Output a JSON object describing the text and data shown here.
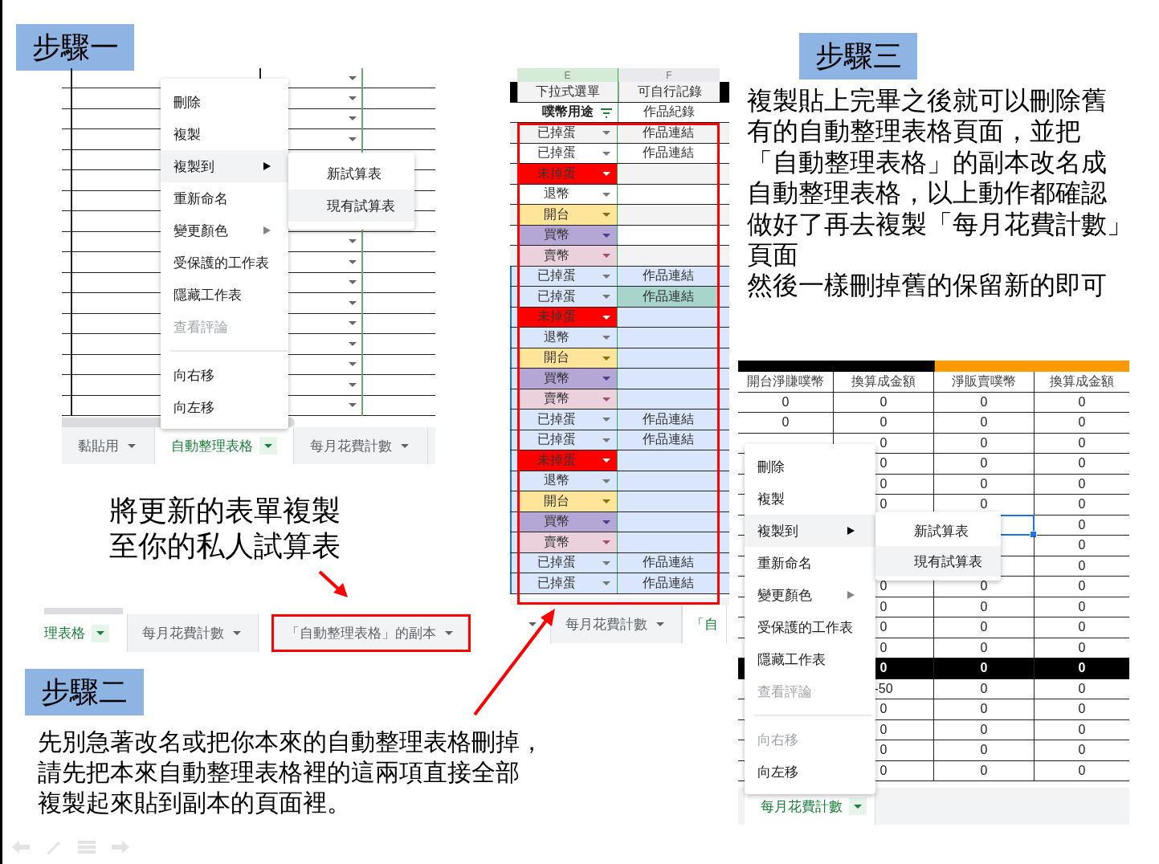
{
  "step1": {
    "label": "步驟一"
  },
  "sheet_a": {
    "menu": [
      {
        "kind": "item",
        "label": "刪除",
        "selected": false,
        "disabled": false,
        "submenu": false
      },
      {
        "kind": "item",
        "label": "複製",
        "selected": false,
        "disabled": false,
        "submenu": false
      },
      {
        "kind": "item",
        "label": "複製到",
        "selected": true,
        "disabled": false,
        "submenu": true
      },
      {
        "kind": "item",
        "label": "重新命名",
        "selected": false,
        "disabled": false,
        "submenu": false
      },
      {
        "kind": "item",
        "label": "變更顏色",
        "selected": false,
        "disabled": false,
        "submenu": true
      },
      {
        "kind": "item",
        "label": "受保護的工作表",
        "selected": false,
        "disabled": false,
        "submenu": false
      },
      {
        "kind": "item",
        "label": "隱藏工作表",
        "selected": false,
        "disabled": false,
        "submenu": false
      },
      {
        "kind": "item",
        "label": "查看評論",
        "selected": false,
        "disabled": true,
        "submenu": false
      },
      {
        "kind": "divider"
      },
      {
        "kind": "item",
        "label": "向右移",
        "selected": false,
        "disabled": false,
        "submenu": false
      },
      {
        "kind": "item",
        "label": "向左移",
        "selected": false,
        "disabled": false,
        "submenu": false
      }
    ],
    "submenu": [
      {
        "label": "新試算表",
        "selected": false
      },
      {
        "label": "現有試算表",
        "selected": true
      }
    ],
    "tabs": [
      {
        "label": "黏貼用",
        "selected": false
      },
      {
        "label": "自動整理表格",
        "selected": true
      },
      {
        "label": "每月花費計數",
        "selected": false
      }
    ]
  },
  "caption": [
    "將更新的表單複製",
    "至你的私人試算表"
  ],
  "tabs_b": [
    {
      "label": "理表格",
      "selected": true,
      "outlined": false
    },
    {
      "label": "每月花費計數",
      "selected": false,
      "outlined": false
    },
    {
      "label": "「自動整理表格」的副本",
      "selected": false,
      "outlined": true
    }
  ],
  "step2": {
    "label": "步驟二",
    "text": [
      "先別急著改名或把你本來的自動整理表格刪掉，",
      "請先把本來自動整理表格裡的這兩項直接全部",
      "複製起來貼到副本的頁面裡。"
    ]
  },
  "sheet_b": {
    "columns": [
      "E",
      "F"
    ],
    "headers": [
      "下拉式選單",
      "可自行記錄"
    ],
    "subheaders": [
      "噗幣用途",
      "作品紀錄"
    ],
    "rows": [
      {
        "status": "已掉蛋",
        "kind": "hatched",
        "selected": false,
        "link": {
          "text": "作品連結",
          "highlighted": false
        }
      },
      {
        "status": "已掉蛋",
        "kind": "hatched",
        "selected": false,
        "link": {
          "text": "作品連結",
          "highlighted": false
        }
      },
      {
        "status": "未掉蛋",
        "kind": "unhatched",
        "selected": false
      },
      {
        "status": "退幣",
        "kind": "refund",
        "selected": false
      },
      {
        "status": "開台",
        "kind": "open",
        "selected": false
      },
      {
        "status": "買幣",
        "kind": "buy",
        "selected": false
      },
      {
        "status": "賣幣",
        "kind": "sell",
        "selected": false
      },
      {
        "status": "已掉蛋",
        "kind": "hatched",
        "selected": true,
        "link": {
          "text": "作品連結",
          "highlighted": false
        }
      },
      {
        "status": "已掉蛋",
        "kind": "hatched",
        "selected": true,
        "link": {
          "text": "作品連結",
          "highlighted": true
        }
      },
      {
        "status": "未掉蛋",
        "kind": "unhatched",
        "selected": true
      },
      {
        "status": "退幣",
        "kind": "refund",
        "selected": true
      },
      {
        "status": "開台",
        "kind": "open",
        "selected": true
      },
      {
        "status": "買幣",
        "kind": "buy",
        "selected": true
      },
      {
        "status": "賣幣",
        "kind": "sell",
        "selected": true
      },
      {
        "status": "已掉蛋",
        "kind": "hatched",
        "selected": true,
        "link": {
          "text": "作品連結",
          "highlighted": false
        }
      },
      {
        "status": "已掉蛋",
        "kind": "hatched",
        "selected": true,
        "link": {
          "text": "作品連結",
          "highlighted": false
        }
      },
      {
        "status": "未掉蛋",
        "kind": "unhatched",
        "selected": true
      },
      {
        "status": "退幣",
        "kind": "refund",
        "selected": true
      },
      {
        "status": "開台",
        "kind": "open",
        "selected": true
      },
      {
        "status": "買幣",
        "kind": "buy",
        "selected": true
      },
      {
        "status": "賣幣",
        "kind": "sell",
        "selected": true
      },
      {
        "status": "已掉蛋",
        "kind": "hatched",
        "selected": true,
        "link": {
          "text": "作品連結",
          "highlighted": false
        }
      },
      {
        "status": "已掉蛋",
        "kind": "hatched",
        "selected": true,
        "link": {
          "text": "作品連結",
          "highlighted": false
        }
      }
    ],
    "tabs": [
      {
        "label": "每月花費計數",
        "selected": false
      },
      {
        "label": "「自",
        "selected": true
      }
    ]
  },
  "step3": {
    "label": "步驟三",
    "text": [
      "複製貼上完畢之後就可以刪除舊",
      "有的自動整理表格頁面，並把",
      "「自動整理表格」的副本改名成",
      "自動整理表格，以上動作都確認",
      "做好了再去複製「每月花費計數」",
      "頁面",
      "然後一樣刪掉舊的保留新的即可"
    ]
  },
  "sheet_c": {
    "headers": [
      "開台淨賺噗幣",
      "換算成金額",
      "淨販賣噗幣",
      "換算成金額"
    ],
    "rows": [
      {
        "kind": "normal",
        "selected": false,
        "cells": [
          "0",
          "0",
          "0",
          "0"
        ]
      },
      {
        "kind": "normal",
        "selected": false,
        "cells": [
          "0",
          "0",
          "0",
          "0"
        ]
      },
      {
        "kind": "normal",
        "selected": false,
        "cells": [
          null,
          "0",
          "0",
          "0"
        ]
      },
      {
        "kind": "normal",
        "selected": false,
        "cells": [
          null,
          "0",
          "0",
          "0"
        ]
      },
      {
        "kind": "normal",
        "selected": false,
        "cells": [
          null,
          "0",
          "0",
          "0"
        ]
      },
      {
        "kind": "normal",
        "selected": false,
        "cells": [
          null,
          "0",
          "0",
          "0"
        ]
      },
      {
        "kind": "normal",
        "selected": true,
        "cells": [
          null,
          null,
          null,
          "0"
        ]
      },
      {
        "kind": "normal",
        "selected": false,
        "cells": [
          null,
          null,
          null,
          "0"
        ]
      },
      {
        "kind": "normal",
        "selected": false,
        "cells": [
          null,
          null,
          null,
          "0"
        ]
      },
      {
        "kind": "normal",
        "selected": false,
        "cells": [
          null,
          "0",
          "0",
          "0"
        ]
      },
      {
        "kind": "normal",
        "selected": false,
        "cells": [
          null,
          "0",
          "0",
          "0"
        ]
      },
      {
        "kind": "normal",
        "selected": false,
        "cells": [
          null,
          "0",
          "0",
          "0"
        ]
      },
      {
        "kind": "normal",
        "selected": false,
        "cells": [
          null,
          "0",
          "0",
          "0"
        ]
      },
      {
        "kind": "total",
        "selected": false,
        "cells": [
          null,
          "0",
          "0",
          "0"
        ]
      },
      {
        "kind": "normal",
        "selected": false,
        "cells": [
          null,
          "-50",
          "0",
          "0"
        ]
      },
      {
        "kind": "normal",
        "selected": false,
        "cells": [
          null,
          "0",
          "0",
          "0"
        ]
      },
      {
        "kind": "normal",
        "selected": false,
        "cells": [
          null,
          "0",
          "0",
          "0"
        ]
      },
      {
        "kind": "normal",
        "selected": false,
        "cells": [
          null,
          "0",
          "0",
          "0"
        ]
      },
      {
        "kind": "normal",
        "selected": false,
        "cells": [
          null,
          "0",
          "0",
          "0"
        ]
      }
    ],
    "menu": [
      {
        "kind": "item",
        "label": "刪除",
        "selected": false,
        "disabled": false,
        "submenu": false
      },
      {
        "kind": "item",
        "label": "複製",
        "selected": false,
        "disabled": false,
        "submenu": false
      },
      {
        "kind": "item",
        "label": "複製到",
        "selected": true,
        "disabled": false,
        "submenu": true
      },
      {
        "kind": "item",
        "label": "重新命名",
        "selected": false,
        "disabled": false,
        "submenu": false
      },
      {
        "kind": "item",
        "label": "變更顏色",
        "selected": false,
        "disabled": false,
        "submenu": true
      },
      {
        "kind": "item",
        "label": "受保護的工作表",
        "selected": false,
        "disabled": false,
        "submenu": false
      },
      {
        "kind": "item",
        "label": "隱藏工作表",
        "selected": false,
        "disabled": false,
        "submenu": false
      },
      {
        "kind": "item",
        "label": "查看評論",
        "selected": false,
        "disabled": true,
        "submenu": false
      },
      {
        "kind": "divider"
      },
      {
        "kind": "item",
        "label": "向右移",
        "selected": false,
        "disabled": true,
        "submenu": false
      },
      {
        "kind": "item",
        "label": "向左移",
        "selected": false,
        "disabled": false,
        "submenu": false
      }
    ],
    "submenu": [
      {
        "label": "新試算表",
        "selected": false
      },
      {
        "label": "現有試算表",
        "selected": true
      }
    ],
    "tabs": [
      {
        "label": "每月花費計數",
        "selected": true
      }
    ]
  }
}
